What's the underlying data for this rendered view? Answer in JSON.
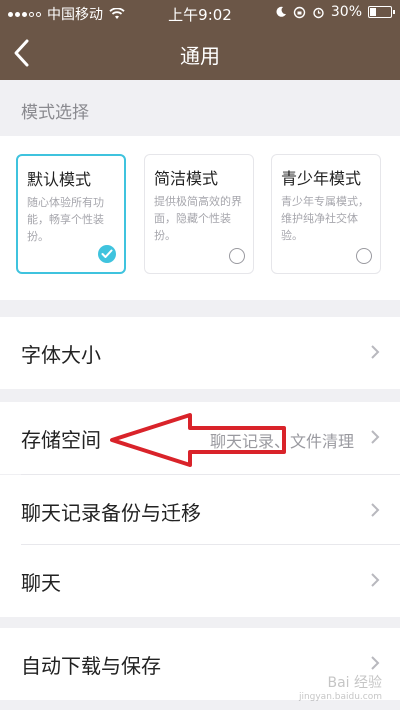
{
  "status_bar": {
    "carrier": "中国移动",
    "time": "上午9:02",
    "battery": "30%",
    "battery_level": 0.3
  },
  "nav": {
    "title": "通用",
    "back_icon": "chevron-left-icon"
  },
  "mode_section": {
    "label": "模式选择",
    "cards": [
      {
        "name": "默认模式",
        "desc": "随心体验所有功能，畅享个性装扮。",
        "selected": true
      },
      {
        "name": "简洁模式",
        "desc": "提供极简高效的界面，隐藏个性装扮。",
        "selected": false
      },
      {
        "name": "青少年模式",
        "desc": "青少年专属模式，维护纯净社交体验。",
        "selected": false
      }
    ]
  },
  "settings": [
    {
      "label": "字体大小",
      "detail": ""
    },
    {
      "label": "存储空间",
      "detail": "聊天记录、文件清理"
    },
    {
      "label": "聊天记录备份与迁移",
      "detail": ""
    },
    {
      "label": "聊天",
      "detail": ""
    },
    {
      "label": "自动下载与保存",
      "detail": ""
    }
  ],
  "watermark": {
    "brand": "Bai 经验",
    "sub": "jingyan.baidu.com"
  },
  "colors": {
    "header": "#6b5647",
    "accent": "#3fc3de",
    "annotation_arrow": "#d9232a"
  }
}
